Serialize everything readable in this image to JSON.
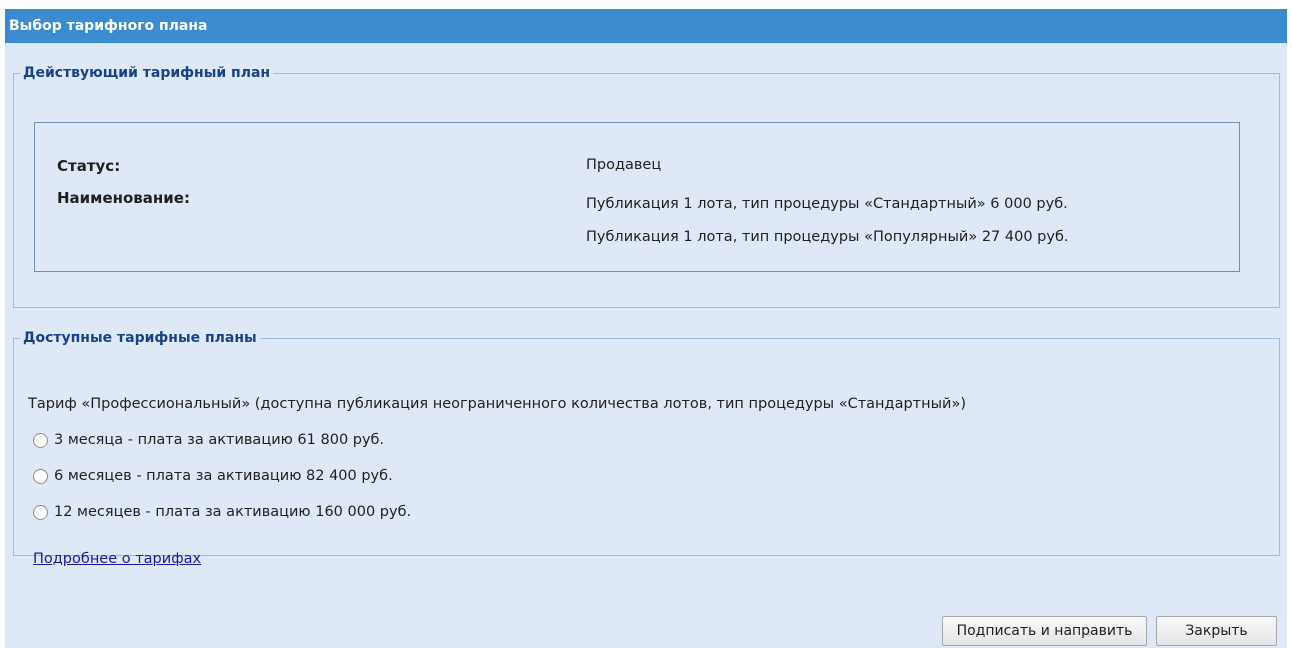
{
  "window": {
    "title": "Выбор тарифного плана"
  },
  "current_plan": {
    "legend": "Действующий тарифный план",
    "status_label": "Статус:",
    "status_value": "Продавец",
    "name_label": "Наименование:",
    "name_values": [
      "Публикация 1 лота, тип процедуры «Стандартный» 6 000 руб.",
      "Публикация 1 лота, тип процедуры «Популярный» 27 400 руб."
    ]
  },
  "available_plans": {
    "legend": "Доступные тарифные планы",
    "description": "Тариф «Профессиональный» (доступна публикация неограниченного количества лотов, тип процедуры «Стандартный»)",
    "options": [
      {
        "label": "3 месяца - плата за активацию 61 800 руб.",
        "selected": false
      },
      {
        "label": "6 месяцев - плата за активацию 82 400 руб.",
        "selected": false
      },
      {
        "label": "12 месяцев - плата за активацию 160 000 руб.",
        "selected": false
      }
    ],
    "more_link": "Подробнее о тарифах"
  },
  "buttons": {
    "sign_label": "Подписать и направить",
    "close_label": "Закрыть"
  }
}
